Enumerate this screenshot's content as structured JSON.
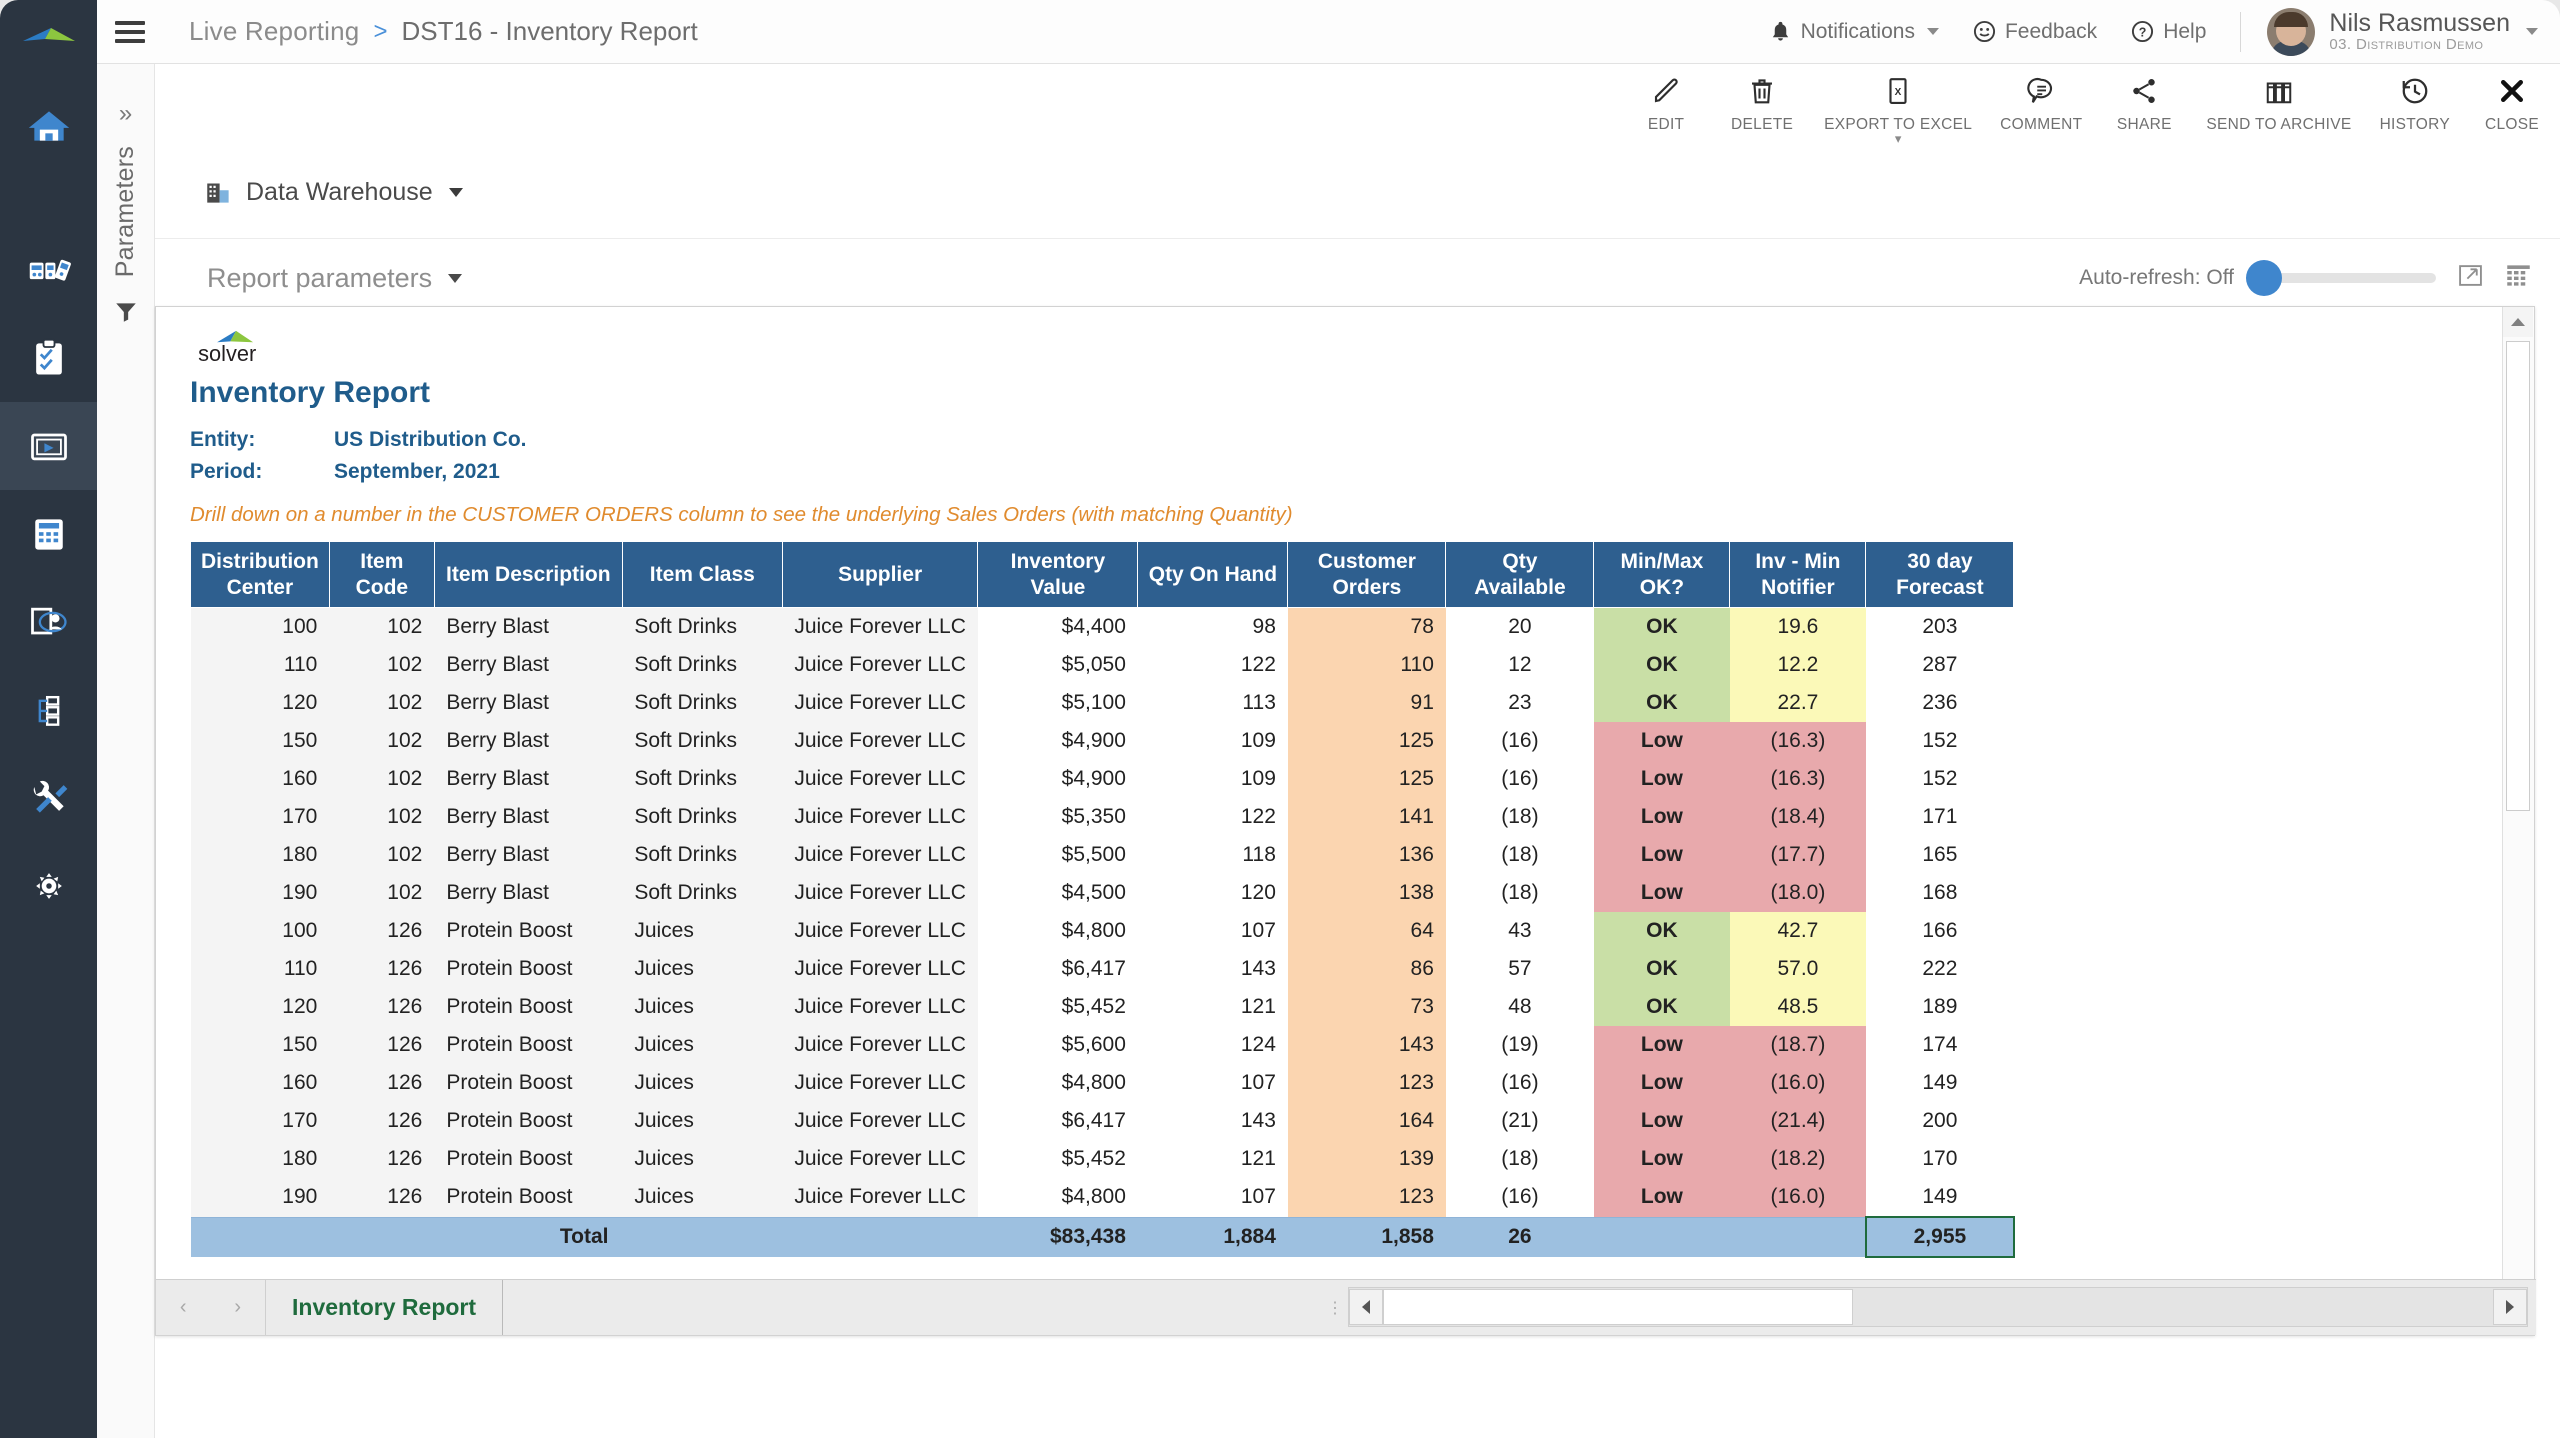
{
  "header": {
    "breadcrumb_root": "Live Reporting",
    "breadcrumb_sep": ">",
    "breadcrumb_current": "DST16 - Inventory Report",
    "notifications": "Notifications",
    "feedback": "Feedback",
    "help": "Help",
    "user_name": "Nils Rasmussen",
    "user_sub": "03. Distribution Demo"
  },
  "toolbar": [
    {
      "label": "EDIT",
      "icon": "pencil-icon",
      "has_submenu": false
    },
    {
      "label": "DELETE",
      "icon": "trash-icon",
      "has_submenu": false
    },
    {
      "label": "EXPORT TO EXCEL",
      "icon": "excel-icon",
      "has_submenu": true
    },
    {
      "label": "COMMENT",
      "icon": "comment-icon",
      "has_submenu": false
    },
    {
      "label": "SHARE",
      "icon": "share-icon",
      "has_submenu": false
    },
    {
      "label": "SEND TO ARCHIVE",
      "icon": "archive-icon",
      "has_submenu": false
    },
    {
      "label": "HISTORY",
      "icon": "history-icon",
      "has_submenu": false
    },
    {
      "label": "CLOSE",
      "icon": "close-icon",
      "has_submenu": false
    }
  ],
  "params_panel": {
    "vertical_label": "Parameters",
    "expand_chevron": "»"
  },
  "canvas": {
    "data_source": "Data Warehouse",
    "report_parameters": "Report parameters",
    "auto_refresh": "Auto-refresh: Off"
  },
  "sidebar": {
    "items": [
      {
        "name": "home",
        "icon": "home-icon"
      },
      {
        "name": "dashboards",
        "icon": "dashboards-icon"
      },
      {
        "name": "tasks",
        "icon": "clipboard-check-icon"
      },
      {
        "name": "reporting",
        "icon": "report-player-icon",
        "active": true
      },
      {
        "name": "budgeting",
        "icon": "calculator-icon"
      },
      {
        "name": "data-entry",
        "icon": "document-user-icon"
      },
      {
        "name": "workflow",
        "icon": "workflow-icon"
      },
      {
        "name": "tools",
        "icon": "tools-icon"
      },
      {
        "name": "settings",
        "icon": "gear-icon"
      }
    ]
  },
  "report": {
    "logo_alt": "solver",
    "title": "Inventory Report",
    "meta": [
      {
        "key": "Entity:",
        "value": "US Distribution Co."
      },
      {
        "key": "Period:",
        "value": "September, 2021"
      }
    ],
    "note": "Drill down on a number in the CUSTOMER ORDERS column to see the underlying Sales Orders (with matching Quantity)",
    "columns": [
      "Distribution Center",
      "Item Code",
      "Item Description",
      "Item Class",
      "Supplier",
      "Inventory Value",
      "Qty On Hand",
      "Customer Orders",
      "Qty Available",
      "Min/Max OK?",
      "Inv - Min Notifier",
      "30 day Forecast"
    ],
    "rows": [
      {
        "dc": "100",
        "code": "102",
        "desc": "Berry Blast",
        "cls": "Soft Drinks",
        "sup": "Juice Forever LLC",
        "inv": "$4,400",
        "qoh": "98",
        "co": "78",
        "qa": "20",
        "qa_neg": false,
        "mm": "OK",
        "notif": "19.6",
        "fc": "203"
      },
      {
        "dc": "110",
        "code": "102",
        "desc": "Berry Blast",
        "cls": "Soft Drinks",
        "sup": "Juice Forever LLC",
        "inv": "$5,050",
        "qoh": "122",
        "co": "110",
        "qa": "12",
        "qa_neg": false,
        "mm": "OK",
        "notif": "12.2",
        "fc": "287"
      },
      {
        "dc": "120",
        "code": "102",
        "desc": "Berry Blast",
        "cls": "Soft Drinks",
        "sup": "Juice Forever LLC",
        "inv": "$5,100",
        "qoh": "113",
        "co": "91",
        "qa": "23",
        "qa_neg": false,
        "mm": "OK",
        "notif": "22.7",
        "fc": "236"
      },
      {
        "dc": "150",
        "code": "102",
        "desc": "Berry Blast",
        "cls": "Soft Drinks",
        "sup": "Juice Forever LLC",
        "inv": "$4,900",
        "qoh": "109",
        "co": "125",
        "qa": "(16)",
        "qa_neg": true,
        "mm": "Low",
        "notif": "(16.3)",
        "fc": "152"
      },
      {
        "dc": "160",
        "code": "102",
        "desc": "Berry Blast",
        "cls": "Soft Drinks",
        "sup": "Juice Forever LLC",
        "inv": "$4,900",
        "qoh": "109",
        "co": "125",
        "qa": "(16)",
        "qa_neg": true,
        "mm": "Low",
        "notif": "(16.3)",
        "fc": "152"
      },
      {
        "dc": "170",
        "code": "102",
        "desc": "Berry Blast",
        "cls": "Soft Drinks",
        "sup": "Juice Forever LLC",
        "inv": "$5,350",
        "qoh": "122",
        "co": "141",
        "qa": "(18)",
        "qa_neg": true,
        "mm": "Low",
        "notif": "(18.4)",
        "fc": "171"
      },
      {
        "dc": "180",
        "code": "102",
        "desc": "Berry Blast",
        "cls": "Soft Drinks",
        "sup": "Juice Forever LLC",
        "inv": "$5,500",
        "qoh": "118",
        "co": "136",
        "qa": "(18)",
        "qa_neg": true,
        "mm": "Low",
        "notif": "(17.7)",
        "fc": "165"
      },
      {
        "dc": "190",
        "code": "102",
        "desc": "Berry Blast",
        "cls": "Soft Drinks",
        "sup": "Juice Forever LLC",
        "inv": "$4,500",
        "qoh": "120",
        "co": "138",
        "qa": "(18)",
        "qa_neg": true,
        "mm": "Low",
        "notif": "(18.0)",
        "fc": "168"
      },
      {
        "dc": "100",
        "code": "126",
        "desc": "Protein Boost",
        "cls": "Juices",
        "sup": "Juice Forever LLC",
        "inv": "$4,800",
        "qoh": "107",
        "co": "64",
        "qa": "43",
        "qa_neg": false,
        "mm": "OK",
        "notif": "42.7",
        "fc": "166"
      },
      {
        "dc": "110",
        "code": "126",
        "desc": "Protein Boost",
        "cls": "Juices",
        "sup": "Juice Forever LLC",
        "inv": "$6,417",
        "qoh": "143",
        "co": "86",
        "qa": "57",
        "qa_neg": false,
        "mm": "OK",
        "notif": "57.0",
        "fc": "222"
      },
      {
        "dc": "120",
        "code": "126",
        "desc": "Protein Boost",
        "cls": "Juices",
        "sup": "Juice Forever LLC",
        "inv": "$5,452",
        "qoh": "121",
        "co": "73",
        "qa": "48",
        "qa_neg": false,
        "mm": "OK",
        "notif": "48.5",
        "fc": "189"
      },
      {
        "dc": "150",
        "code": "126",
        "desc": "Protein Boost",
        "cls": "Juices",
        "sup": "Juice Forever LLC",
        "inv": "$5,600",
        "qoh": "124",
        "co": "143",
        "qa": "(19)",
        "qa_neg": true,
        "mm": "Low",
        "notif": "(18.7)",
        "fc": "174"
      },
      {
        "dc": "160",
        "code": "126",
        "desc": "Protein Boost",
        "cls": "Juices",
        "sup": "Juice Forever LLC",
        "inv": "$4,800",
        "qoh": "107",
        "co": "123",
        "qa": "(16)",
        "qa_neg": true,
        "mm": "Low",
        "notif": "(16.0)",
        "fc": "149"
      },
      {
        "dc": "170",
        "code": "126",
        "desc": "Protein Boost",
        "cls": "Juices",
        "sup": "Juice Forever LLC",
        "inv": "$6,417",
        "qoh": "143",
        "co": "164",
        "qa": "(21)",
        "qa_neg": true,
        "mm": "Low",
        "notif": "(21.4)",
        "fc": "200"
      },
      {
        "dc": "180",
        "code": "126",
        "desc": "Protein Boost",
        "cls": "Juices",
        "sup": "Juice Forever LLC",
        "inv": "$5,452",
        "qoh": "121",
        "co": "139",
        "qa": "(18)",
        "qa_neg": true,
        "mm": "Low",
        "notif": "(18.2)",
        "fc": "170"
      },
      {
        "dc": "190",
        "code": "126",
        "desc": "Protein Boost",
        "cls": "Juices",
        "sup": "Juice Forever LLC",
        "inv": "$4,800",
        "qoh": "107",
        "co": "123",
        "qa": "(16)",
        "qa_neg": true,
        "mm": "Low",
        "notif": "(16.0)",
        "fc": "149"
      }
    ],
    "total": {
      "label": "Total",
      "inv": "$83,438",
      "qoh": "1,884",
      "co": "1,858",
      "qa": "26",
      "mm": "",
      "notif": "",
      "fc": "2,955"
    }
  },
  "sheet_tabs": {
    "prev": "‹",
    "next": "›",
    "tabs": [
      "Inventory Report"
    ]
  },
  "colors": {
    "header_blue": "#2e5f8f",
    "total_blue": "#9dc0e0",
    "orange": "#fbd5b0",
    "green": "#c9dfa6",
    "red": "#e8a9ac",
    "yellow": "#fbf9b8",
    "accent": "#3f86cd",
    "note_orange": "#e08b2e",
    "rail": "#2b3541"
  }
}
